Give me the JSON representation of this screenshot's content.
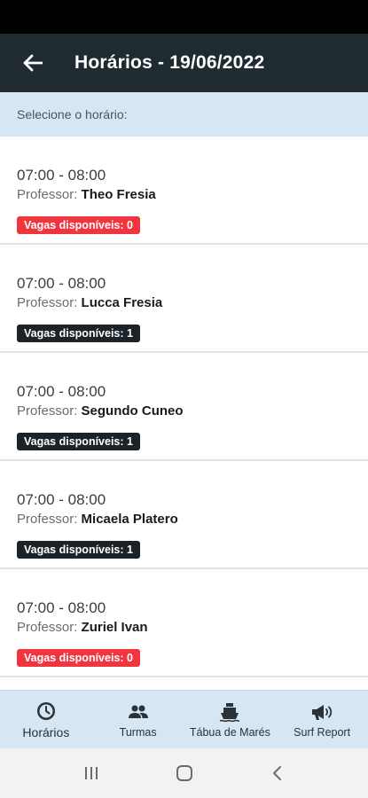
{
  "app_bar": {
    "title": "Horários - 19/06/2022",
    "back_icon": "arrow-left-icon"
  },
  "subheader": {
    "text": "Selecione o horário:"
  },
  "schedule": [
    {
      "time": "07:00 - 08:00",
      "professor_label": "Professor:",
      "professor_name": "Theo Fresia",
      "vagas": "Vagas disponíveis: 0",
      "status": "red"
    },
    {
      "time": "07:00 - 08:00",
      "professor_label": "Professor:",
      "professor_name": "Lucca Fresia",
      "vagas": "Vagas disponíveis: 1",
      "status": "dark"
    },
    {
      "time": "07:00 - 08:00",
      "professor_label": "Professor:",
      "professor_name": "Segundo Cuneo",
      "vagas": "Vagas disponíveis: 1",
      "status": "dark"
    },
    {
      "time": "07:00 - 08:00",
      "professor_label": "Professor:",
      "professor_name": "Micaela Platero",
      "vagas": "Vagas disponíveis: 1",
      "status": "dark"
    },
    {
      "time": "07:00 - 08:00",
      "professor_label": "Professor:",
      "professor_name": "Zuriel Ivan",
      "vagas": "Vagas disponíveis: 0",
      "status": "red"
    }
  ],
  "bottom_nav": [
    {
      "label": "Horários",
      "icon": "clock-icon",
      "active": true
    },
    {
      "label": "Turmas",
      "icon": "people-icon",
      "active": false
    },
    {
      "label": "Tábua de Marés",
      "icon": "ship-icon",
      "active": false
    },
    {
      "label": "Surf Report",
      "icon": "megaphone-icon",
      "active": false
    }
  ],
  "system_nav": {
    "recents_icon": "recents-icon",
    "home_icon": "home-icon",
    "back_icon": "back-chevron-icon"
  },
  "colors": {
    "app_bar": "#1f2a31",
    "subheader": "#d6e6f3",
    "badge_red": "#f0353f",
    "badge_dark": "#1b2228"
  }
}
